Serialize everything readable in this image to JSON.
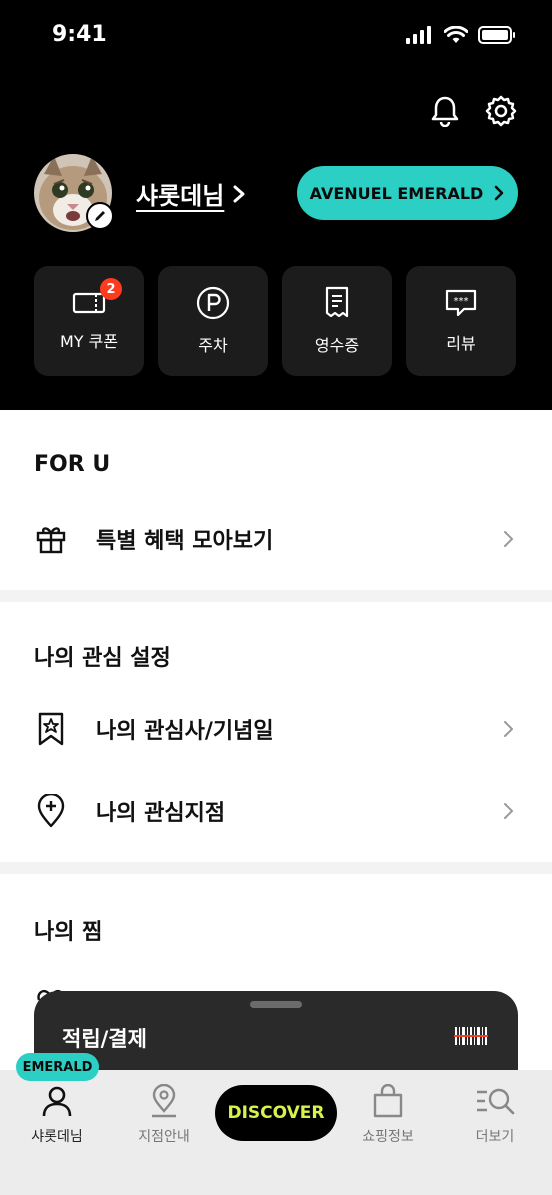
{
  "status_bar": {
    "time": "9:41"
  },
  "header": {
    "user_name": "샤롯데님",
    "tier_button": "AVENUEL EMERALD",
    "quick_menu": [
      {
        "label": "MY 쿠폰",
        "icon": "coupon-icon",
        "badge": "2"
      },
      {
        "label": "주차",
        "icon": "parking-icon"
      },
      {
        "label": "영수증",
        "icon": "receipt-icon"
      },
      {
        "label": "리뷰",
        "icon": "review-icon"
      }
    ]
  },
  "for_u": {
    "title": "FOR U",
    "items": [
      {
        "label": "특별 혜택 모아보기",
        "icon": "gift-icon"
      }
    ]
  },
  "interests": {
    "title": "나의 관심 설정",
    "items": [
      {
        "label": "나의 관심사/기념일",
        "icon": "bookmark-star-icon"
      },
      {
        "label": "나의 관심지점",
        "icon": "location-plus-icon"
      }
    ]
  },
  "wishlist": {
    "title": "나의 찜"
  },
  "bottom_sheet": {
    "title": "적립/결제",
    "icon": "barcode-icon"
  },
  "tab_bar": {
    "badge": "EMERALD",
    "discover": "DISCOVER",
    "tabs": [
      {
        "label": "샤롯데님",
        "icon": "person-icon"
      },
      {
        "label": "지점안내",
        "icon": "map-pin-icon"
      },
      {
        "label": "쇼핑정보",
        "icon": "shopping-bag-icon"
      },
      {
        "label": "더보기",
        "icon": "menu-search-icon"
      }
    ]
  },
  "colors": {
    "accent": "#2bcfc4",
    "discover_text": "#d9f24a",
    "badge_red": "#ff3b1f"
  }
}
